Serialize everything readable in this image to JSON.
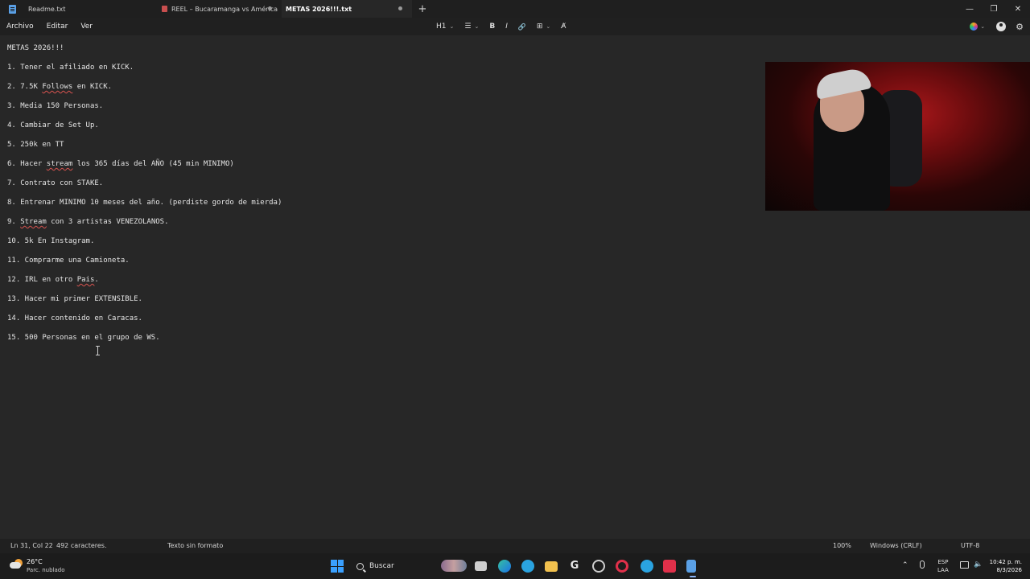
{
  "tabs": [
    {
      "label": "Readme.txt",
      "active": false,
      "modified": false
    },
    {
      "label": "REEL – Bucaramanga vs América",
      "active": false,
      "modified": true
    },
    {
      "label": "METAS 2026!!!.txt",
      "active": true,
      "modified": true
    }
  ],
  "window_controls": {
    "minimize": "—",
    "maximize": "❐",
    "close": "✕"
  },
  "menu": [
    "Archivo",
    "Editar",
    "Ver"
  ],
  "toolbar": {
    "heading": "H1",
    "list": "☰",
    "bold": "B",
    "italic": "I",
    "link": "🔗",
    "table": "⊞",
    "clear": "A̸"
  },
  "document": {
    "lines": [
      "METAS 2026!!!",
      "1. Tener el afiliado en KICK.",
      "2. 7.5K Follows en KICK.",
      "3. Media 150 Personas.",
      "4. Cambiar de Set Up.",
      "5. 250k en TT",
      "6. Hacer stream los 365 días del AÑO (45 min MINIMO)",
      "7. Contrato con STAKE.",
      "8. Entrenar MINIMO 10 meses del año. (perdiste gordo de mierda)",
      "9. Stream con 3 artistas VENEZOLANOS.",
      "10. 5k En Instagram.",
      "11. Comprarme una Camioneta.",
      "12. IRL en otro Pais.",
      "13. Hacer mi primer EXTENSIBLE.",
      "14. Hacer contenido en Caracas.",
      "15. 500 Personas en el grupo de WS."
    ]
  },
  "status": {
    "position": "Ln 31, Col 22",
    "chars": "492 caracteres.",
    "format": "Texto sin formato",
    "zoom": "100%",
    "eol": "Windows (CRLF)",
    "encoding": "UTF-8"
  },
  "taskbar": {
    "weather_temp": "26°C",
    "weather_desc": "Parc. nublado",
    "search_label": "Buscar",
    "lang_line1": "ESP",
    "lang_line2": "LAA",
    "time": "10:42 p. m.",
    "date": "8/3/2026"
  },
  "colors": {
    "accent": "#3aa0ff",
    "spell_error": "#d9534f"
  }
}
